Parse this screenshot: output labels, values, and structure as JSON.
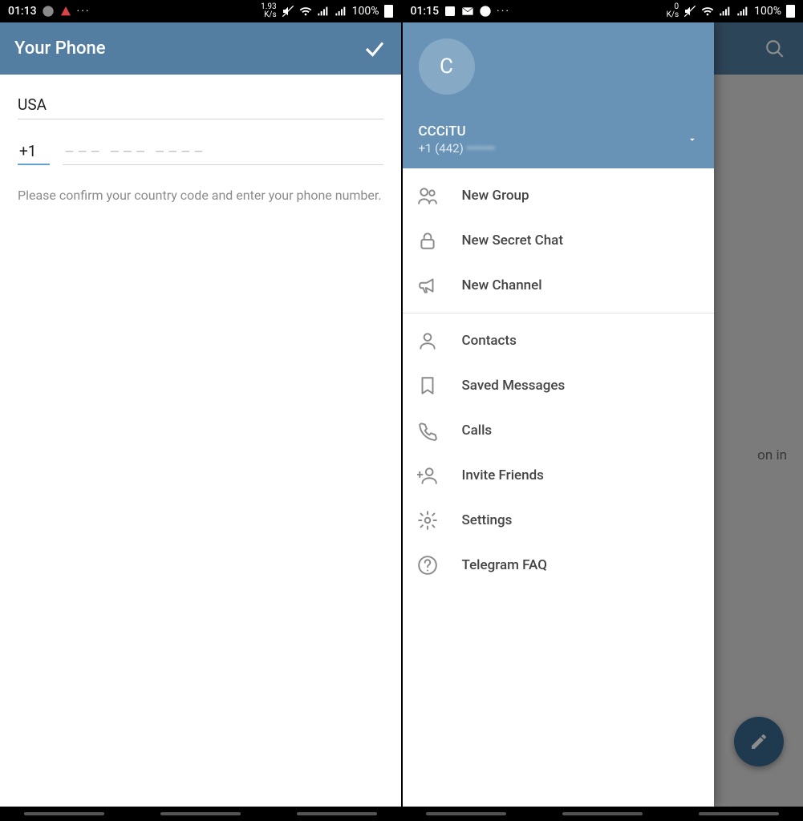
{
  "left": {
    "status": {
      "clock": "01:13",
      "dots": "···",
      "speed_top": "1.93",
      "speed_unit": "K/s",
      "battery": "100%"
    },
    "appbar": {
      "title": "Your Phone"
    },
    "form": {
      "country": "USA",
      "code": "+1",
      "placeholder": "––– ––– ––––",
      "hint": "Please confirm your country code and enter your phone number."
    }
  },
  "right": {
    "status": {
      "clock": "01:15",
      "dots": "···",
      "speed_top": "0",
      "speed_unit": "K/s",
      "battery": "100%"
    },
    "bg_text": "on in",
    "drawer": {
      "avatar_letter": "C",
      "name": "CCCiTU",
      "phone": "+1 (442)",
      "items1": [
        {
          "icon": "group",
          "label": "New Group"
        },
        {
          "icon": "lock",
          "label": "New Secret Chat"
        },
        {
          "icon": "megaphone",
          "label": "New Channel"
        }
      ],
      "items2": [
        {
          "icon": "person",
          "label": "Contacts"
        },
        {
          "icon": "bookmark",
          "label": "Saved Messages"
        },
        {
          "icon": "call",
          "label": "Calls"
        },
        {
          "icon": "invite",
          "label": "Invite Friends"
        },
        {
          "icon": "settings",
          "label": "Settings"
        },
        {
          "icon": "help",
          "label": "Telegram FAQ"
        }
      ]
    }
  }
}
